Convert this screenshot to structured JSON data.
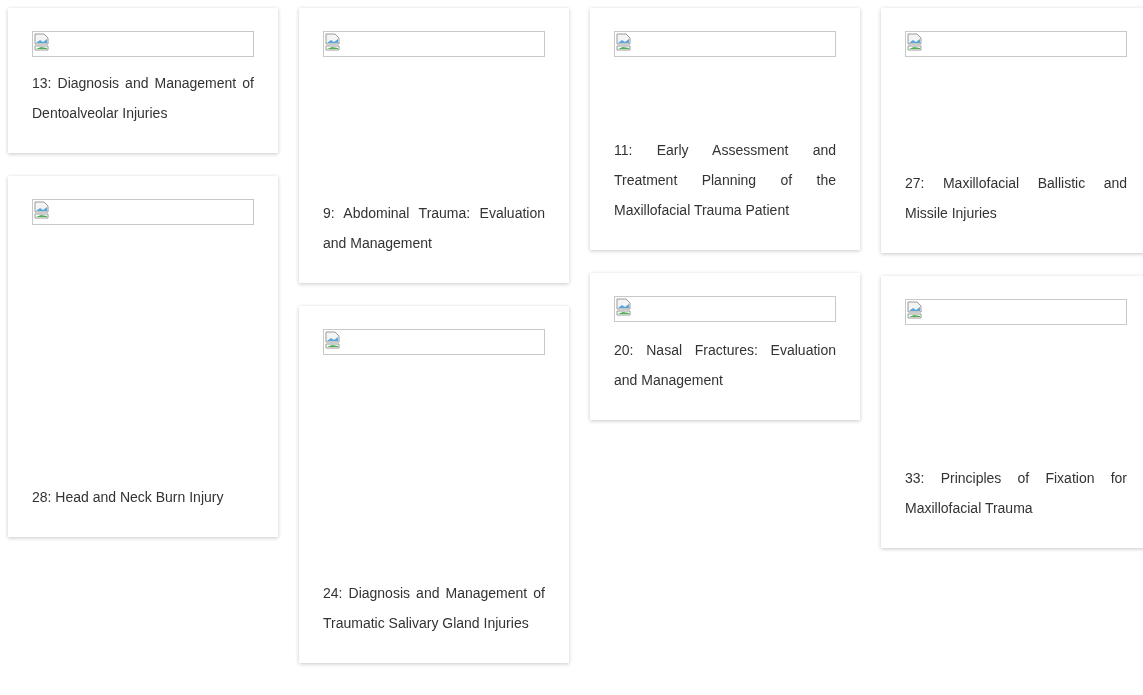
{
  "columns": [
    {
      "cards": [
        {
          "title": "13: Diagnosis and Management of Dentoalveolar Injuries"
        },
        {
          "title": "28: Head and Neck Burn Injury"
        }
      ]
    },
    {
      "cards": [
        {
          "title": "9: Abdominal Trauma: Evaluation and Management"
        },
        {
          "title": "24: Diagnosis and Management of Traumatic Salivary Gland Injuries"
        }
      ]
    },
    {
      "cards": [
        {
          "title": "11: Early Assessment and Treatment Planning of the Maxillofacial Trauma Patient"
        },
        {
          "title": "20: Nasal Fractures: Evaluation and Management"
        }
      ]
    },
    {
      "cards": [
        {
          "title": "27: Maxillofacial Ballistic and Missile Injuries"
        },
        {
          "title": "33: Principles of Fixation for Maxillofacial Trauma"
        }
      ]
    }
  ]
}
